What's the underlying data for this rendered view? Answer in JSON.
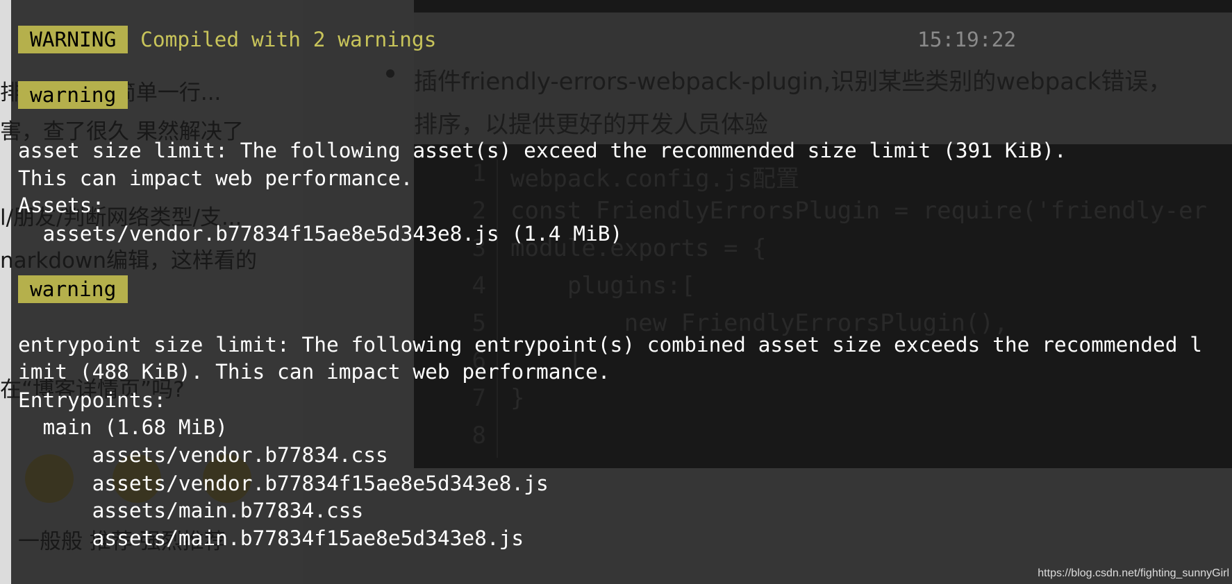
{
  "background": {
    "left_texts": [
      "排页眉页脚 简单一行...",
      "害，查了很久 果然解决了",
      "l/朋友/判断网络类型/支...",
      "narkdown编辑，这样看的",
      "在“博客详情页”吗?",
      "一般般  推荐  强烈推荐"
    ],
    "bullet_lines": [
      "插件friendly-errors-webpack-plugin,识别某些类别的webpack错误，",
      "排序，以提供更好的开发人员体验"
    ],
    "code_line_numbers": [
      "1",
      "2",
      "3",
      "4",
      "5",
      "6",
      "7",
      "8"
    ],
    "code_lines": [
      "webpack.config.js配置",
      "const FriendlyErrorsPlugin = require('friendly-er",
      "module.exports = {",
      "    plugins:[",
      "        new FriendlyErrorsPlugin(),",
      "    ]",
      "}",
      ""
    ]
  },
  "terminal": {
    "header_badge": "WARNING",
    "header_message": "Compiled with 2 warnings",
    "time": "15:19:22",
    "warnings": [
      {
        "badge": "warning",
        "lines": [
          "asset size limit: The following asset(s) exceed the recommended size limit (391 KiB).",
          "This can impact web performance.",
          "Assets:",
          "  assets/vendor.b77834f15ae8e5d343e8.js (1.4 MiB)"
        ]
      },
      {
        "badge": "warning",
        "lines": [
          "entrypoint size limit: The following entrypoint(s) combined asset size exceeds the recommended l",
          "imit (488 KiB). This can impact web performance.",
          "Entrypoints:",
          "  main (1.68 MiB)",
          "      assets/vendor.b77834.css",
          "      assets/vendor.b77834f15ae8e5d343e8.js",
          "      assets/main.b77834.css",
          "      assets/main.b77834f15ae8e5d343e8.js"
        ]
      }
    ]
  },
  "watermark": "https://blog.csdn.net/fighting_sunnyGirl",
  "colors": {
    "badge": "#b5b04c",
    "header_text": "#c8c45a",
    "terminal_bg": "#1c1c1c"
  }
}
